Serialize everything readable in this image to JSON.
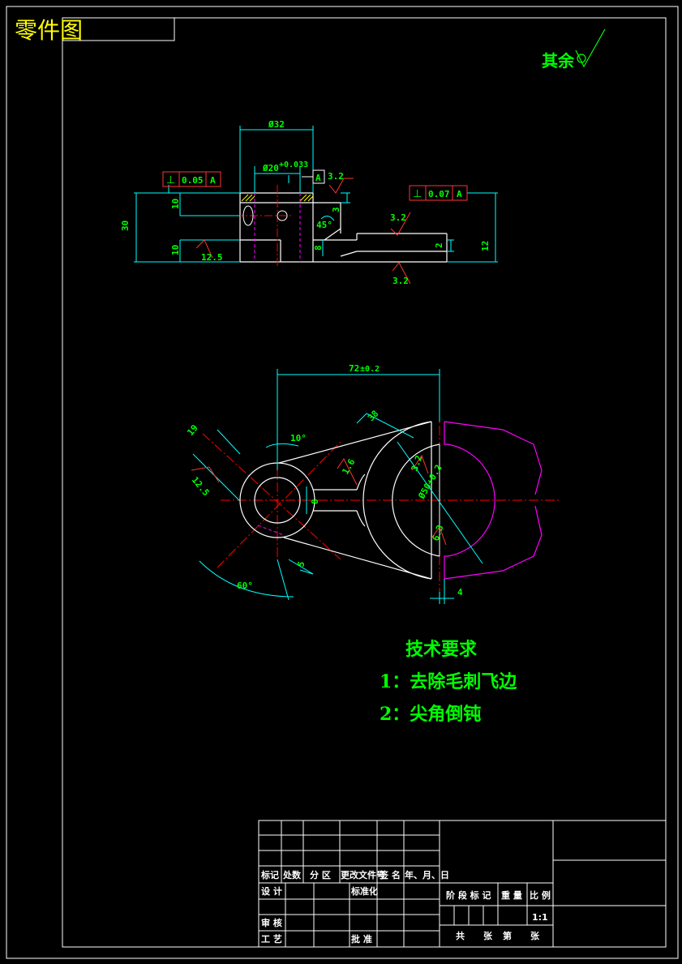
{
  "title_block_label": "零件图",
  "surface_finish_note": "其余",
  "colors": {
    "background": "#000000",
    "outline": "#ffffff",
    "dimension": "#00ffff",
    "text": "#00ff00",
    "tolerance_frame": "#ff3333",
    "centerline": "#ff0000",
    "hidden": "#ff00ff",
    "title": "#ffff00"
  },
  "front_view": {
    "dims": {
      "d32": "Ø32",
      "d20": "Ø20",
      "d20_tol": "+0.033",
      "h30": "30",
      "h10_top": "10",
      "h10_bot": "10",
      "h3": "3",
      "h8": "8",
      "h2": "2",
      "h12": "12",
      "angle45": "45°"
    },
    "roughness": [
      "3.2",
      "3.2",
      "3.2",
      "12.5"
    ],
    "tolerance1": {
      "symbol": "⊥",
      "value": "0.05",
      "datum": "A"
    },
    "tolerance2": {
      "symbol": "⊥",
      "value": "0.07",
      "datum": "A"
    },
    "datum_label": "A"
  },
  "top_view": {
    "dims": {
      "d72": "72",
      "d72_tol": "±0.2",
      "r38": "38",
      "d19": "19",
      "d8": "8",
      "d5": "5",
      "d4": "4",
      "a10": "10°",
      "a60": "60°",
      "phi": "Ø50+0.2"
    },
    "roughness": [
      "12.5",
      "1.6",
      "3.2",
      "6.3"
    ]
  },
  "tech_requirements": {
    "heading": "技术要求",
    "items": [
      "1：去除毛刺飞边",
      "2：尖角倒钝"
    ]
  },
  "title_block": {
    "headers": [
      "标记",
      "处数",
      "分 区",
      "更改文件号",
      "签 名",
      "年、月、日"
    ],
    "row_design": "设 计",
    "row_standard": "标准化",
    "row_review": "审 核",
    "row_process": "工 艺",
    "row_approve": "批 准",
    "stage_mark": "阶 段 标 记",
    "weight": "重 量",
    "scale_label": "比 例",
    "scale_value": "1:1",
    "sheet_total": "共",
    "sheet_unit": "张",
    "sheet_nth": "第",
    "sheet_unit2": "张"
  }
}
